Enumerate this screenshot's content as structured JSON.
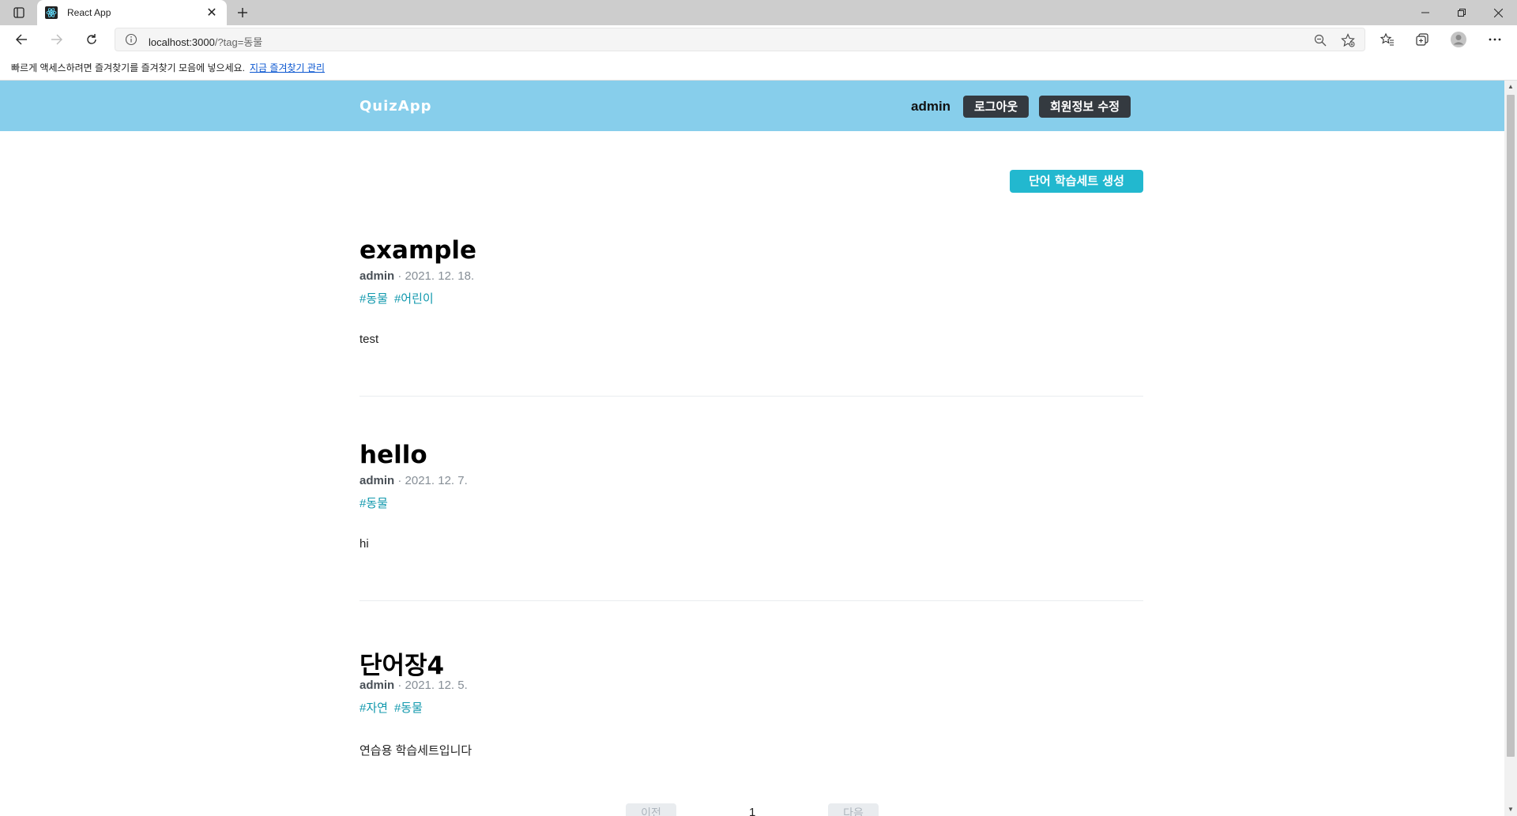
{
  "browser": {
    "tab_title": "React App",
    "url_host": "localhost:3000",
    "url_path": "/?tag=동물",
    "favorites_prompt": "빠르게 액세스하려면 즐겨찾기를 즐겨찾기 모음에 넣으세요.",
    "favorites_link": "지금 즐겨찾기 관리"
  },
  "header": {
    "logo": "QuizApp",
    "username": "admin",
    "logout_label": "로그아웃",
    "edit_profile_label": "회원정보 수정"
  },
  "actions": {
    "create_label": "단어 학습세트 생성"
  },
  "posts": [
    {
      "title": "example",
      "author": "admin",
      "date": "2021. 12. 18.",
      "tags": [
        "#동물",
        "#어린이"
      ],
      "body": "test"
    },
    {
      "title": "hello",
      "author": "admin",
      "date": "2021. 12. 7.",
      "tags": [
        "#동물"
      ],
      "body": "hi"
    },
    {
      "title": "단어장4",
      "author": "admin",
      "date": "2021. 12. 5.",
      "tags": [
        "#자연",
        "#동물"
      ],
      "body": "연습용 학습세트입니다"
    }
  ],
  "pagination": {
    "prev_label": "이전",
    "page": "1",
    "next_label": "다음"
  },
  "colors": {
    "header_bg": "#87ceeb",
    "dark_button": "#343a40",
    "accent": "#22b8cf",
    "tag": "#1098ad"
  }
}
